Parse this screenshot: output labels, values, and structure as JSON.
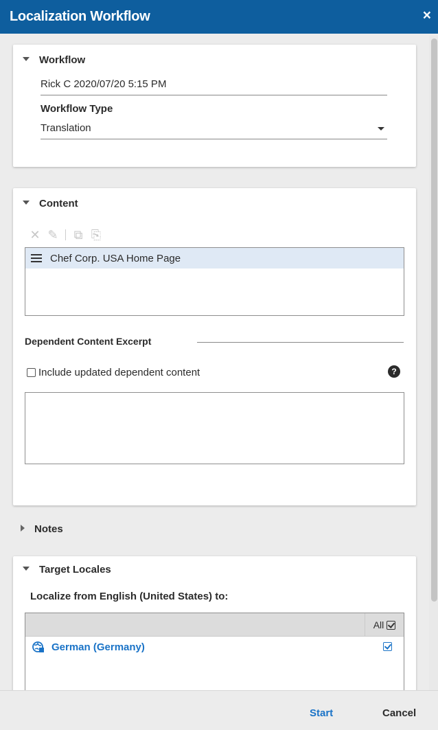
{
  "dialog": {
    "title": "Localization Workflow",
    "close_glyph": "×"
  },
  "workflow": {
    "heading": "Workflow",
    "name_value": "Rick C 2020/07/20 5:15 PM",
    "type_label": "Workflow Type",
    "type_value": "Translation"
  },
  "content": {
    "heading": "Content",
    "toolbar_icons": [
      "remove-icon",
      "edit-icon",
      "copy-icon",
      "paste-icon"
    ],
    "items": [
      {
        "label": "Chef Corp. USA Home Page",
        "icon": "content-type-icon"
      }
    ],
    "dependent_heading": "Dependent Content Excerpt",
    "include_label": "Include updated dependent content",
    "include_checked": false,
    "help_glyph": "?"
  },
  "notes": {
    "heading": "Notes"
  },
  "target_locales": {
    "heading": "Target Locales",
    "from_label": "Localize from English (United States) to:",
    "all_label": "All",
    "all_checked": true,
    "locales": [
      {
        "label": "German (Germany)",
        "checked": true,
        "icon": "globe-icon"
      }
    ]
  },
  "footer": {
    "start_label": "Start",
    "cancel_label": "Cancel"
  },
  "colors": {
    "header": "#0e5e9e",
    "link": "#1a73c7",
    "selected_row": "#dfe9f5"
  }
}
